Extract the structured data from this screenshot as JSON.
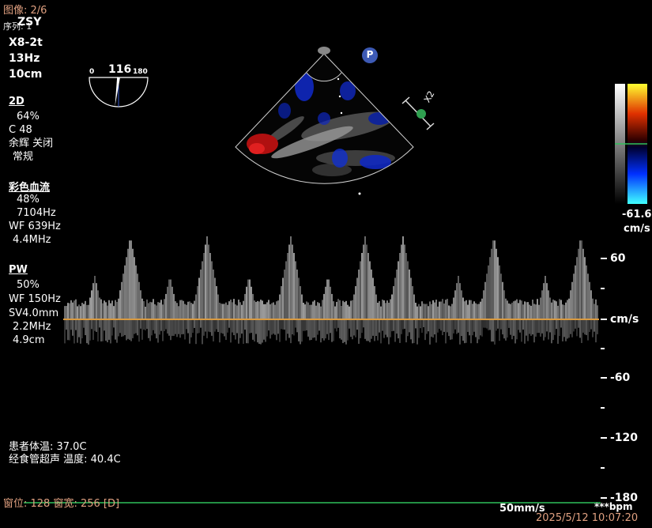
{
  "header": {
    "image_index": "图像: 2/6",
    "hospital_abbr": "ZSY",
    "hospital_sub": "序列: 1"
  },
  "probe": {
    "model": "X8-2t",
    "frame_rate": "13Hz",
    "depth": "10cm"
  },
  "angle_dial": {
    "min_label": "0",
    "value_label": "116",
    "max_label": "180",
    "angle_value": 116
  },
  "params_2d": {
    "title": "2D",
    "gain": "64%",
    "compress": "C 48",
    "persist": "余辉 关闭",
    "mode": "常规"
  },
  "params_color": {
    "title": "彩色血流",
    "gain": "48%",
    "prf": "7104Hz",
    "wall_filter": "WF 639Hz",
    "freq": "4.4MHz"
  },
  "params_pw": {
    "title": "PW",
    "gain": "50%",
    "wall_filter": "WF 150Hz",
    "sample_volume": "SV4.0mm",
    "freq": "2.2MHz",
    "depth": "4.9cm"
  },
  "colorbar": {
    "low_value": "-61.6",
    "unit": "cm/s"
  },
  "doppler_scale": {
    "top": "60",
    "unit": "cm/s",
    "neg1": "-60",
    "neg2": "-120",
    "neg3": "-180"
  },
  "zoom_marker": {
    "label": "X2"
  },
  "p_marker": {
    "label": "P"
  },
  "patient": {
    "body_temp": "患者体温: 37.0C",
    "probe_temp": "经食管超声 温度: 40.4C"
  },
  "footer": {
    "window_level": "窗位: 128 窗宽: 256 [D]",
    "sweep_speed": "50mm/s",
    "heart_rate": "***bpm",
    "datetime": "2025/5/12 10:07:20"
  },
  "colors": {
    "baseline": "#d99a40",
    "ecg": "#2fbf5a",
    "info_orange": "#e0a080",
    "cfm_red": "#b01010",
    "cfm_blue": "#1028c0"
  }
}
